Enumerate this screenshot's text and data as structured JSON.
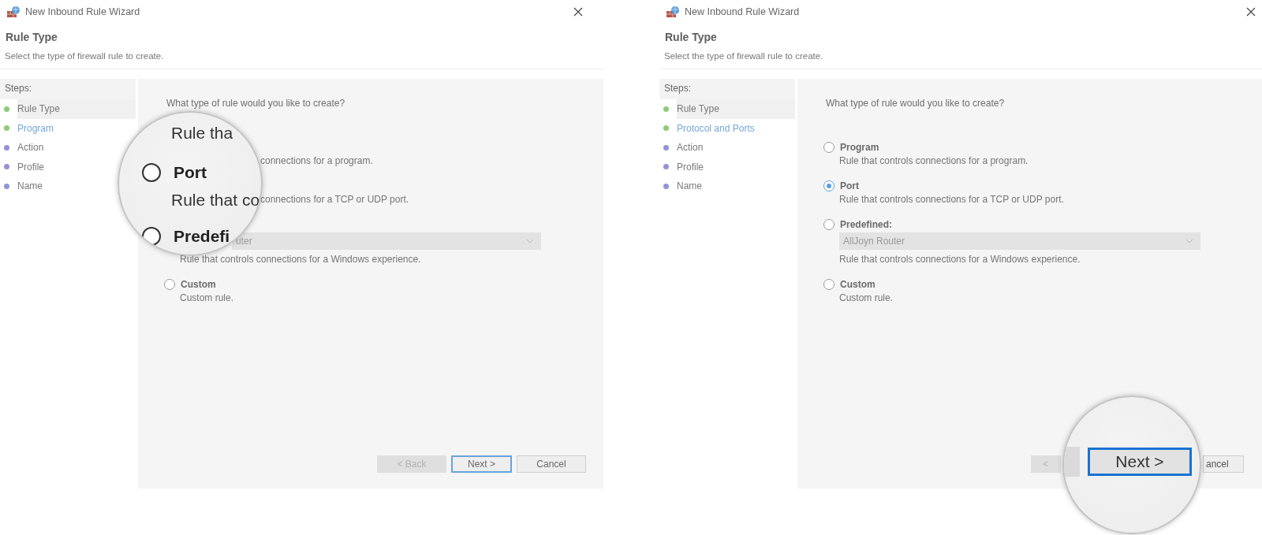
{
  "panels": [
    {
      "window": {
        "title": "New Inbound Rule Wizard"
      },
      "page_title": "Rule Type",
      "page_subtitle": "Select the type of firewall rule to create.",
      "steps_heading": "Steps:",
      "steps": [
        {
          "label": "Rule Type",
          "selected": true,
          "completed": true,
          "current": false
        },
        {
          "label": "Program",
          "selected": false,
          "completed": true,
          "current": true
        },
        {
          "label": "Action",
          "selected": false,
          "completed": false,
          "current": false
        },
        {
          "label": "Profile",
          "selected": false,
          "completed": false,
          "current": false
        },
        {
          "label": "Name",
          "selected": false,
          "completed": false,
          "current": false
        }
      ],
      "question": "What type of rule would you like to create?",
      "options": [
        {
          "kind": "tail",
          "description": "connections for a program."
        },
        {
          "kind": "tail",
          "description": "connections for a TCP or UDP port."
        },
        {
          "kind": "droptail",
          "dropdown": {
            "value": "uter",
            "disabled": true
          },
          "description": "Rule that controls connections for a Windows experience."
        },
        {
          "kind": "full",
          "label": "Custom",
          "selected": false,
          "description": "Custom rule."
        }
      ],
      "buttons": [
        {
          "kind": "full",
          "label": "< Back",
          "disabled": true,
          "default": false
        },
        {
          "kind": "full",
          "label": "Next >",
          "disabled": false,
          "default": true
        },
        {
          "kind": "full",
          "label": "Cancel",
          "disabled": false,
          "default": false
        }
      ],
      "magnifier": {
        "items": [
          {
            "kind": "text",
            "text": "Rule tha"
          },
          {
            "kind": "radio",
            "label": "Port",
            "selected": false
          },
          {
            "kind": "text",
            "text": "Rule that co"
          },
          {
            "kind": "radio",
            "label": "Predefi",
            "selected": false
          }
        ]
      }
    },
    {
      "window": {
        "title": "New Inbound Rule Wizard"
      },
      "page_title": "Rule Type",
      "page_subtitle": "Select the type of firewall rule to create.",
      "steps_heading": "Steps:",
      "steps": [
        {
          "label": "Rule Type",
          "selected": true,
          "completed": true,
          "current": false
        },
        {
          "label": "Protocol and Ports",
          "selected": false,
          "completed": true,
          "current": true
        },
        {
          "label": "Action",
          "selected": false,
          "completed": false,
          "current": false
        },
        {
          "label": "Profile",
          "selected": false,
          "completed": false,
          "current": false
        },
        {
          "label": "Name",
          "selected": false,
          "completed": false,
          "current": false
        }
      ],
      "question": "What type of rule would you like to create?",
      "options": [
        {
          "kind": "full",
          "label": "Program",
          "selected": false,
          "description": "Rule that controls connections for a program."
        },
        {
          "kind": "full",
          "label": "Port",
          "selected": true,
          "description": "Rule that controls connections for a TCP or UDP port."
        },
        {
          "kind": "full",
          "label": "Predefined:",
          "selected": false,
          "dropdown": {
            "value": "AllJoyn Router",
            "disabled": true
          },
          "description": "Rule that controls connections for a Windows experience."
        },
        {
          "kind": "full",
          "label": "Custom",
          "selected": false,
          "description": "Custom rule."
        }
      ],
      "buttons": [
        {
          "kind": "head",
          "label": "<",
          "disabled": true,
          "default": false
        },
        {
          "kind": "tail",
          "label": "ancel",
          "disabled": false,
          "default": false
        }
      ],
      "magnifier": {
        "items": [
          {
            "kind": "button_edge"
          },
          {
            "kind": "button",
            "label": "Next >",
            "default": true
          }
        ]
      }
    }
  ]
}
